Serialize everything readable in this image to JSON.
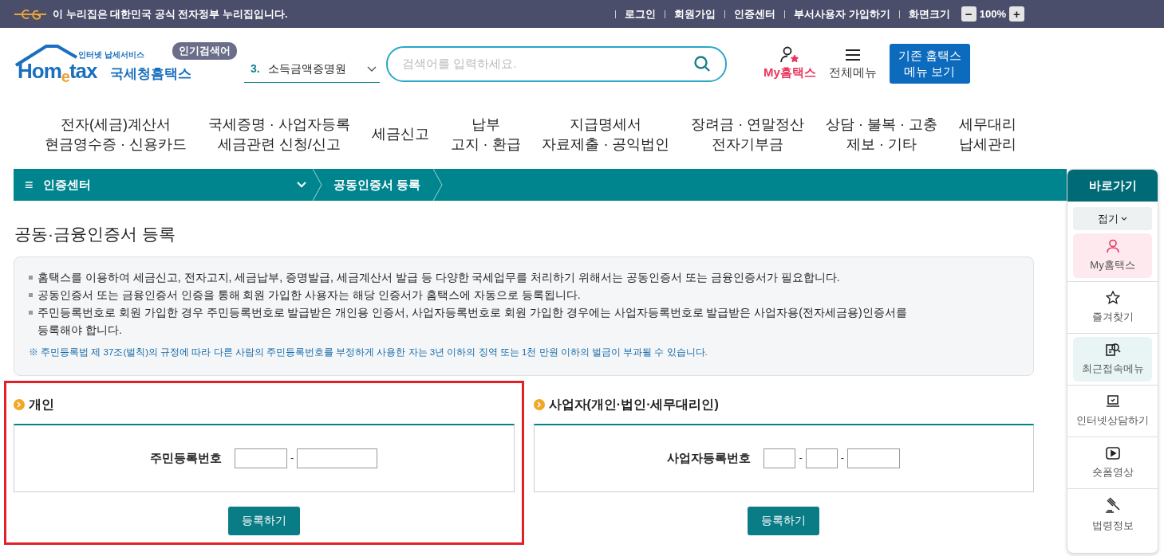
{
  "top_bar": {
    "notice": "이 누리집은 대한민국 공식 전자정부 누리집입니다.",
    "links": [
      "로그인",
      "회원가입",
      "인증센터",
      "부서사용자 가입하기"
    ],
    "zoom_label": "화면크기",
    "zoom_out": "−",
    "zoom_value": "100%",
    "zoom_in": "+"
  },
  "header": {
    "logo_tagline": "인터넷 납세서비스",
    "logo_word": "Hom$_{e}$tax",
    "logo_name": "국세청홈택스",
    "popular_badge": "인기검색어",
    "popular_rank": "3.",
    "popular_term": "소득금액증명원",
    "search_placeholder": "검색어를 입력하세요.",
    "my_label": "My홈택스",
    "menu_label": "전체메뉴",
    "legacy_button": [
      "기존 홈택스",
      "메뉴 보기"
    ]
  },
  "nav": [
    {
      "lines": [
        "전자(세금)계산서",
        "현금영수증 · 신용카드"
      ]
    },
    {
      "lines": [
        "국세증명 · 사업자등록",
        "세금관련 신청/신고"
      ]
    },
    {
      "lines": [
        "세금신고"
      ]
    },
    {
      "lines": [
        "납부",
        "고지 · 환급"
      ]
    },
    {
      "lines": [
        "지급명세서",
        "자료제출 · 공익법인"
      ]
    },
    {
      "lines": [
        "장려금 · 연말정산",
        "전자기부금"
      ]
    },
    {
      "lines": [
        "상담 · 불복 · 고충",
        "제보 · 기타"
      ]
    },
    {
      "lines": [
        "세무대리",
        "납세관리"
      ]
    }
  ],
  "breadcrumb": {
    "menu_icon": "≡",
    "section": "인증센터",
    "current": "공동인증서 등록"
  },
  "page_title": "공동·금융인증서 등록",
  "notices": [
    {
      "lines": [
        "홈택스를 이용하여 세금신고, 전자고지, 세금납부, 증명발급, 세금계산서 발급 등 다양한 국세업무를 처리하기 위해서는 공동인증서 또는 금융인증서가 필요합니다."
      ]
    },
    {
      "lines": [
        "공동인증서 또는 금융인증서 인증을 통해 회원 가입한 사용자는 해당 인증서가 홈택스에 자동으로 등록됩니다."
      ]
    },
    {
      "lines": [
        "주민등록번호로 회원 가입한 경우 주민등록번호로 발급받은 개인용 인증서, 사업자등록번호로 회원 가입한 경우에는 사업자등록번호로 발급받은 사업자용(전자세금용)인증서를",
        "등록해야 합니다."
      ]
    }
  ],
  "legal_note": "※ 주민등록법 제 37조(벌칙)의 규정에 따라 다른 사람의 주민등록번호를 부정하게 사용한 자는 3년 이하의 징역 또는 1천 만원 이하의 벌금이 부과될 수 있습니다.",
  "panels": [
    {
      "title": "개인",
      "field_label": "주민등록번호",
      "separator": "-",
      "inputs": [
        {
          "kind": "medium"
        },
        {
          "kind": "wide"
        }
      ],
      "button": "등록하기",
      "highlighted": true
    },
    {
      "title": "사업자(개인·법인·세무대리인)",
      "field_label": "사업자등록번호",
      "separator": "-",
      "inputs": [
        {
          "kind": "narrow"
        },
        {
          "kind": "narrow"
        },
        {
          "kind": "medium"
        }
      ],
      "button": "등록하기",
      "highlighted": false
    }
  ],
  "quick_menu": {
    "title": "바로가기",
    "collapse": "접기",
    "items": [
      {
        "kind": "person",
        "label": "My홈택스",
        "color": "#fde9ee"
      },
      {
        "kind": "star",
        "label": "즐겨찾기"
      },
      {
        "kind": "recent",
        "label": "최근접속메뉴",
        "color": "#e9f5f5"
      },
      {
        "kind": "laptop",
        "label": "인터넷상담하기"
      },
      {
        "kind": "video",
        "label": "숏폼영상"
      },
      {
        "kind": "gavel",
        "label": "법령정보"
      }
    ]
  }
}
